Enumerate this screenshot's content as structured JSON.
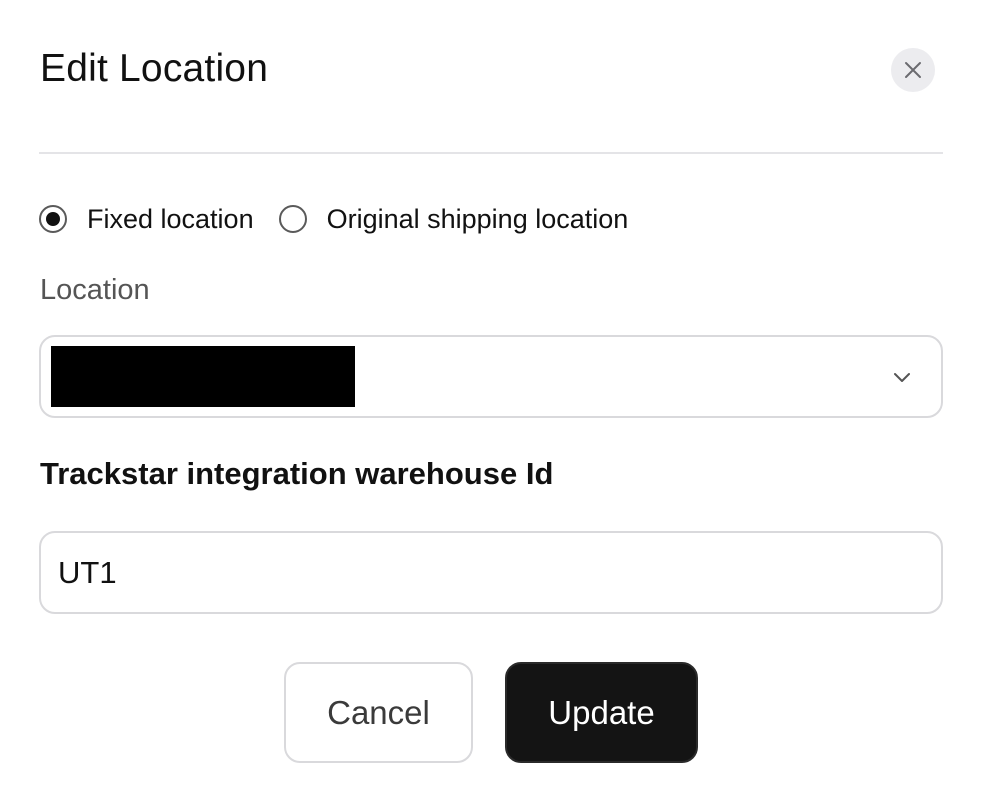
{
  "dialog": {
    "title": "Edit Location",
    "close_icon": "close-icon"
  },
  "location_type": {
    "options": [
      {
        "label": "Fixed location",
        "selected": true
      },
      {
        "label": "Original shipping location",
        "selected": false
      }
    ]
  },
  "location": {
    "label": "Location",
    "value": "",
    "value_redacted": true,
    "dropdown_icon": "chevron-down-icon"
  },
  "warehouse": {
    "label": "Trackstar integration warehouse Id",
    "value": "UT1"
  },
  "actions": {
    "cancel_label": "Cancel",
    "update_label": "Update"
  },
  "colors": {
    "primary_button": "#141414",
    "border": "#d9d9dc",
    "close_button_bg": "#ececef"
  }
}
